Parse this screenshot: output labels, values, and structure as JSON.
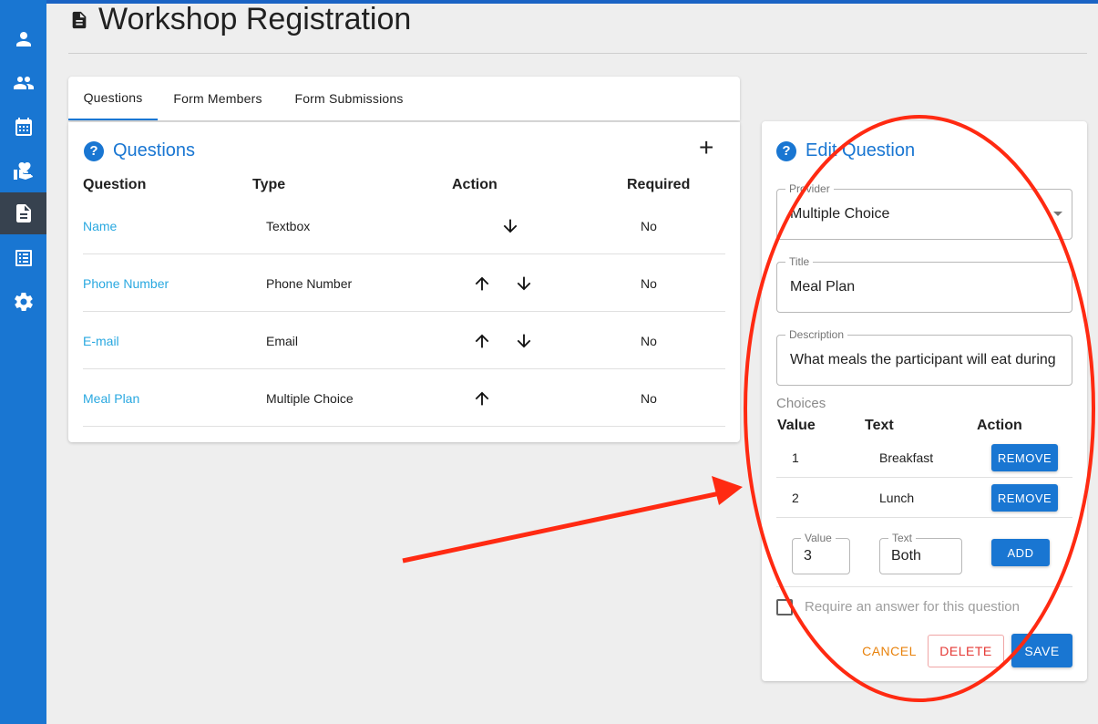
{
  "page": {
    "title": "Workshop Registration"
  },
  "sidebar": {
    "items": [
      {
        "icon": "person-icon"
      },
      {
        "icon": "people-icon"
      },
      {
        "icon": "calendar-icon"
      },
      {
        "icon": "volunteer-icon"
      },
      {
        "icon": "document-icon",
        "active": true
      },
      {
        "icon": "list-alt-icon"
      },
      {
        "icon": "gear-icon"
      }
    ]
  },
  "tabs": [
    {
      "label": "Questions",
      "active": true
    },
    {
      "label": "Form Members"
    },
    {
      "label": "Form Submissions"
    }
  ],
  "questions_card": {
    "title": "Questions",
    "add_label": "+",
    "headers": {
      "question": "Question",
      "type": "Type",
      "action": "Action",
      "required": "Required"
    },
    "rows": [
      {
        "question": "Name",
        "type": "Textbox",
        "up": false,
        "down": true,
        "required": "No"
      },
      {
        "question": "Phone Number",
        "type": "Phone Number",
        "up": true,
        "down": true,
        "required": "No"
      },
      {
        "question": "E-mail",
        "type": "Email",
        "up": true,
        "down": true,
        "required": "No"
      },
      {
        "question": "Meal Plan",
        "type": "Multiple Choice",
        "up": true,
        "down": false,
        "required": "No"
      }
    ]
  },
  "edit_card": {
    "title": "Edit Question",
    "provider": {
      "label": "Provider",
      "value": "Multiple Choice"
    },
    "question_title": {
      "label": "Title",
      "value": "Meal Plan"
    },
    "description": {
      "label": "Description",
      "value": "What meals the participant will eat during"
    },
    "choices_label": "Choices",
    "choice_headers": {
      "value": "Value",
      "text": "Text",
      "action": "Action"
    },
    "choices": [
      {
        "value": "1",
        "text": "Breakfast",
        "action": "REMOVE"
      },
      {
        "value": "2",
        "text": "Lunch",
        "action": "REMOVE"
      }
    ],
    "new_choice": {
      "value_label": "Value",
      "value": "3",
      "text_label": "Text",
      "text": "Both",
      "add": "ADD"
    },
    "require_label": "Require an answer for this question",
    "require_checked": false,
    "buttons": {
      "cancel": "CANCEL",
      "delete": "DELETE",
      "save": "SAVE"
    }
  },
  "colors": {
    "primary": "#1976d2",
    "link": "#29a8e0",
    "cancel": "#e8820c",
    "delete": "#e53935",
    "annotation": "#ff2a12"
  }
}
